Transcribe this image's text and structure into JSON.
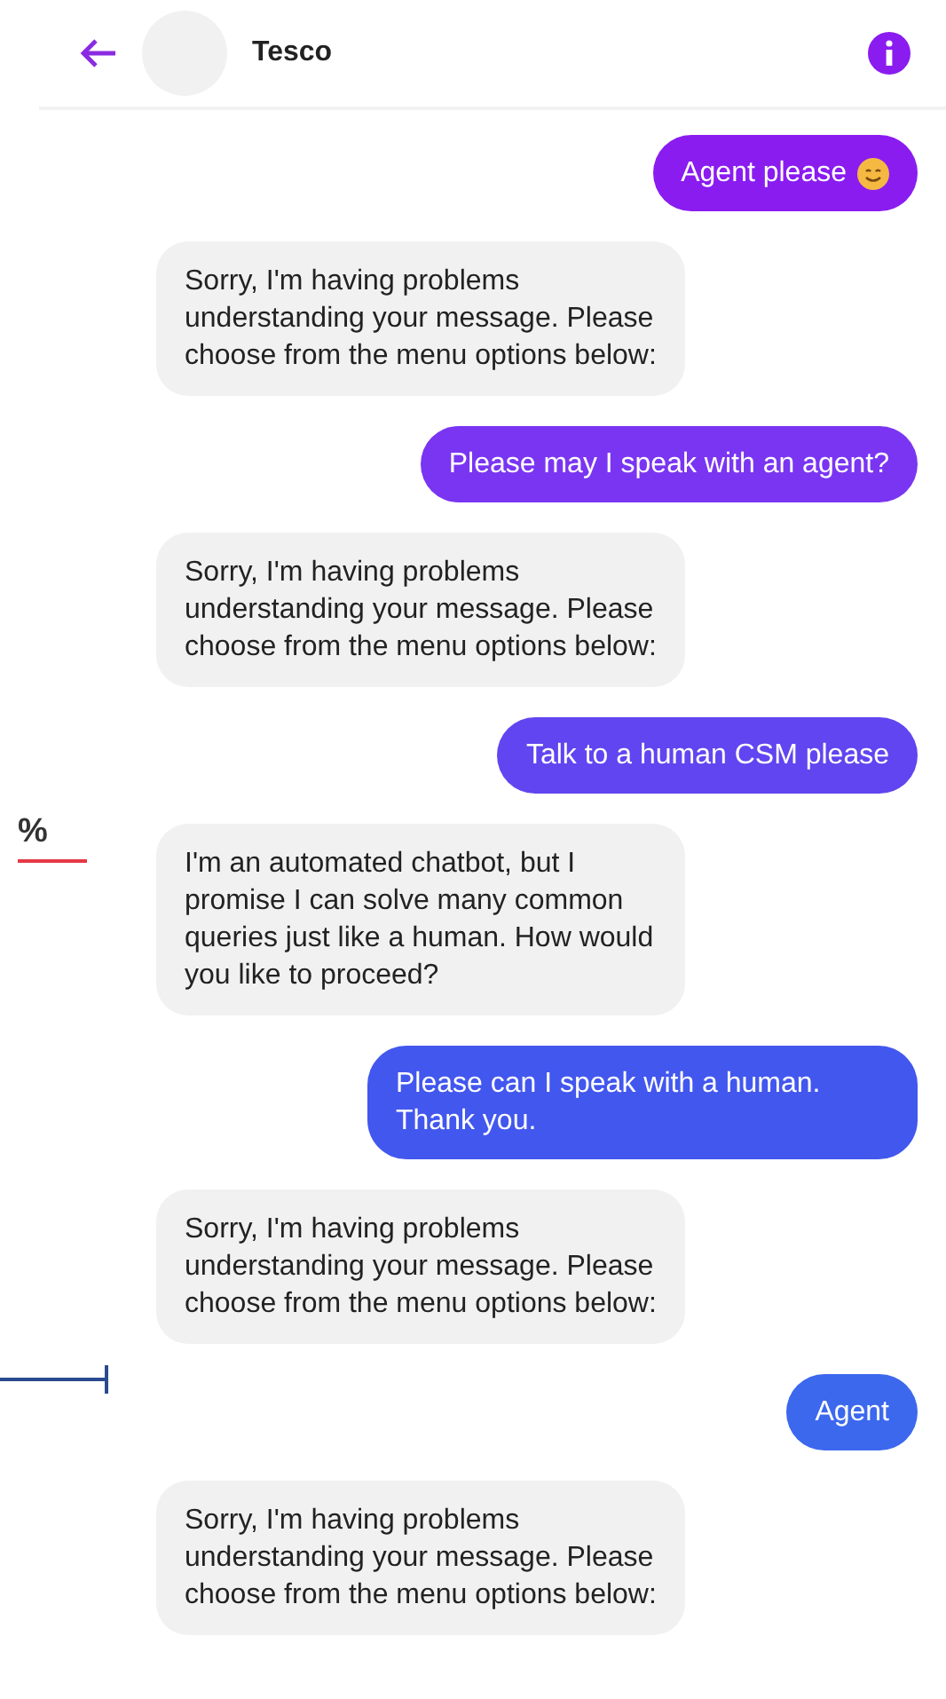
{
  "header": {
    "title": "Tesco"
  },
  "side": {
    "figure": "%"
  },
  "messages": [
    {
      "kind": "user",
      "text": "Agent please",
      "emoji": true,
      "color": "#8a1cf0"
    },
    {
      "kind": "bot",
      "text": "Sorry, I'm having problems understanding your message. Please choose from the menu options below:"
    },
    {
      "kind": "user",
      "text": "Please may I speak with an agent?",
      "emoji": false,
      "color": "#7a35f2"
    },
    {
      "kind": "bot",
      "text": "Sorry, I'm having problems understanding your message. Please choose from the menu options below:"
    },
    {
      "kind": "user",
      "text": "Talk to a human CSM please",
      "emoji": false,
      "color": "#6045f0"
    },
    {
      "kind": "bot",
      "text": "I'm an automated chatbot, but I promise I can solve many common queries just like a human. How would you like to proceed?"
    },
    {
      "kind": "user",
      "text": "Please can I speak with a human. Thank you.",
      "emoji": false,
      "color": "#4257ee"
    },
    {
      "kind": "bot",
      "text": "Sorry, I'm having problems understanding your message. Please choose from the menu options below:"
    },
    {
      "kind": "user",
      "text": "Agent",
      "emoji": false,
      "color": "#3c68ee"
    },
    {
      "kind": "bot",
      "text": "Sorry, I'm having problems understanding your message. Please choose from the menu options below:"
    }
  ]
}
